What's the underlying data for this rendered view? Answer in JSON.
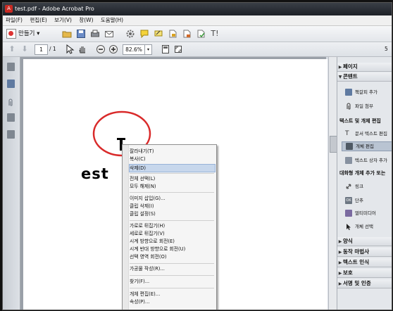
{
  "window": {
    "title": "test.pdf - Adobe Acrobat Pro"
  },
  "menu": {
    "items": [
      "파일(F)",
      "편집(E)",
      "보기(V)",
      "창(W)",
      "도움말(H)"
    ]
  },
  "toolbar1": {
    "create_label": "만들기 ▾",
    "text_tool": "T!"
  },
  "toolbar2": {
    "page_number": "1",
    "page_total": "/ 1",
    "zoom": "82.6%",
    "right_label": "5"
  },
  "document": {
    "text": "est"
  },
  "context_menu": {
    "items": [
      "잘라내기(T)",
      "복사(C)",
      "삭제(D)",
      "전체 선택(L)",
      "모두 해제(N)",
      "이미지 삽입(G)...",
      "클립 삭제(I)",
      "클립 설정(S)",
      "가로로 뒤집기(H)",
      "세로로 뒤집기(V)",
      "시계 방향으로 회전(E)",
      "시계 반대 방향으로 회전(U)",
      "선택 영역 회전(O)",
      "가공물 작성(R)...",
      "찾기(F)...",
      "개체 편집(E)...",
      "속성(P)..."
    ],
    "highlighted": "삭제(D)"
  },
  "right_panel": {
    "sections_top": [
      "페이지",
      "콘텐트"
    ],
    "content_items": [
      "책갈피 추가",
      "파일 첨부"
    ],
    "subheader_text_edit": "텍스트 및 개체 편집",
    "text_edit_items": [
      "문서 텍스트 편집",
      "개체 편집",
      "텍스트 상자 추가"
    ],
    "subheader_interactive": "대화형 개체 추가 또는",
    "interactive_items": [
      "링크",
      "단추",
      "멀티미디어",
      "개체 선택"
    ],
    "sections_bottom": [
      "양식",
      "동작 마법사",
      "텍스트 인식",
      "보호",
      "서명 및 인증"
    ]
  }
}
